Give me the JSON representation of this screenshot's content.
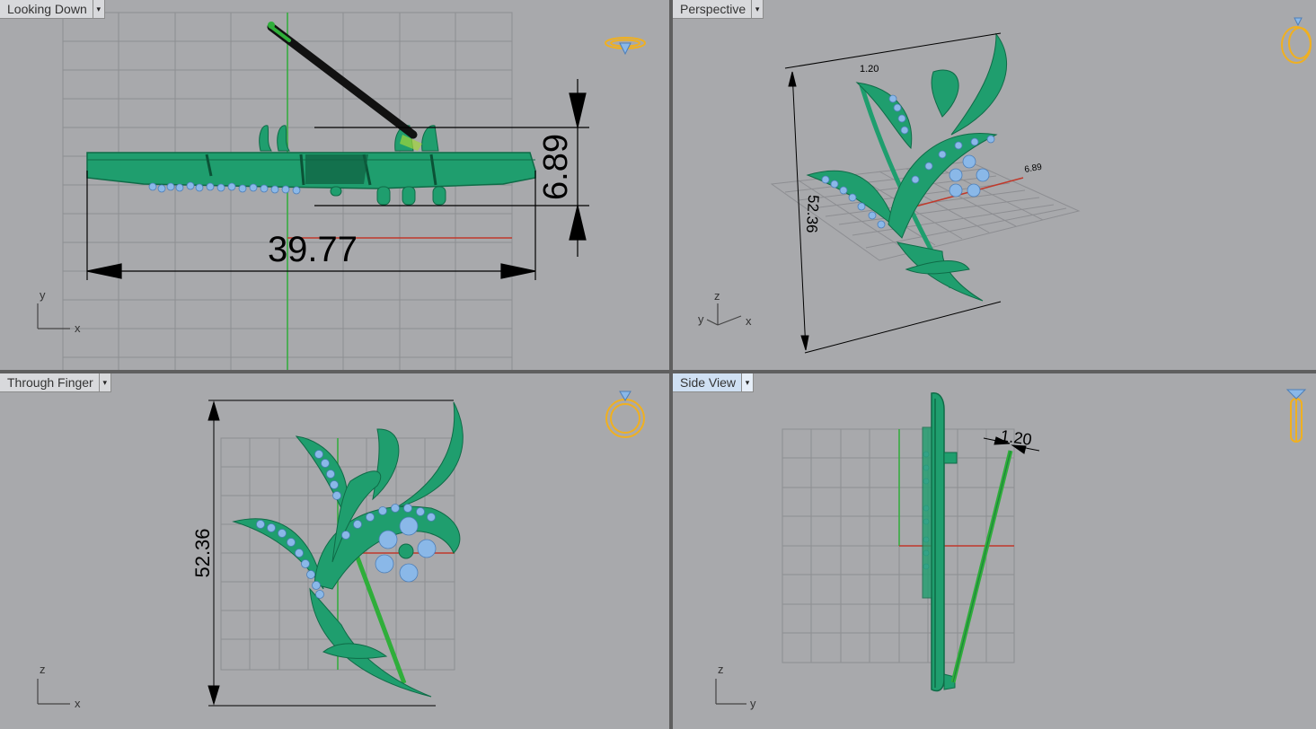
{
  "viewports": {
    "top": {
      "name": "Looking Down",
      "axis_h": "x",
      "axis_v": "y",
      "dim_width": "39.77",
      "dim_height": "6.89"
    },
    "persp": {
      "name": "Perspective",
      "axis_h": "x",
      "axis_v": "z",
      "axis_d": "y",
      "dim_height": "52.36",
      "dim_small": "1.20",
      "dim_small2": "6.89"
    },
    "front": {
      "name": "Through Finger",
      "axis_h": "x",
      "axis_v": "z",
      "dim_height": "52.36"
    },
    "side": {
      "name": "Side View",
      "axis_h": "y",
      "axis_v": "z",
      "dim_pin": "1.20"
    }
  },
  "menu_arrow": "▾",
  "colors": {
    "viewport_bg": "#a8a9ac",
    "grid": "#8d8e92",
    "model_green": "#1f9e6e",
    "model_dark": "#0f6b47",
    "gem_blue": "#8ab8e8",
    "ring_gold": "#f0b020",
    "axis_red": "#c0392b",
    "axis_green": "#2fae3a",
    "active_tab": "#cfe0f3"
  },
  "icons": {
    "top": "ring-top-icon",
    "persp": "ring-perspective-icon",
    "front": "ring-front-icon",
    "side": "ring-side-icon"
  }
}
